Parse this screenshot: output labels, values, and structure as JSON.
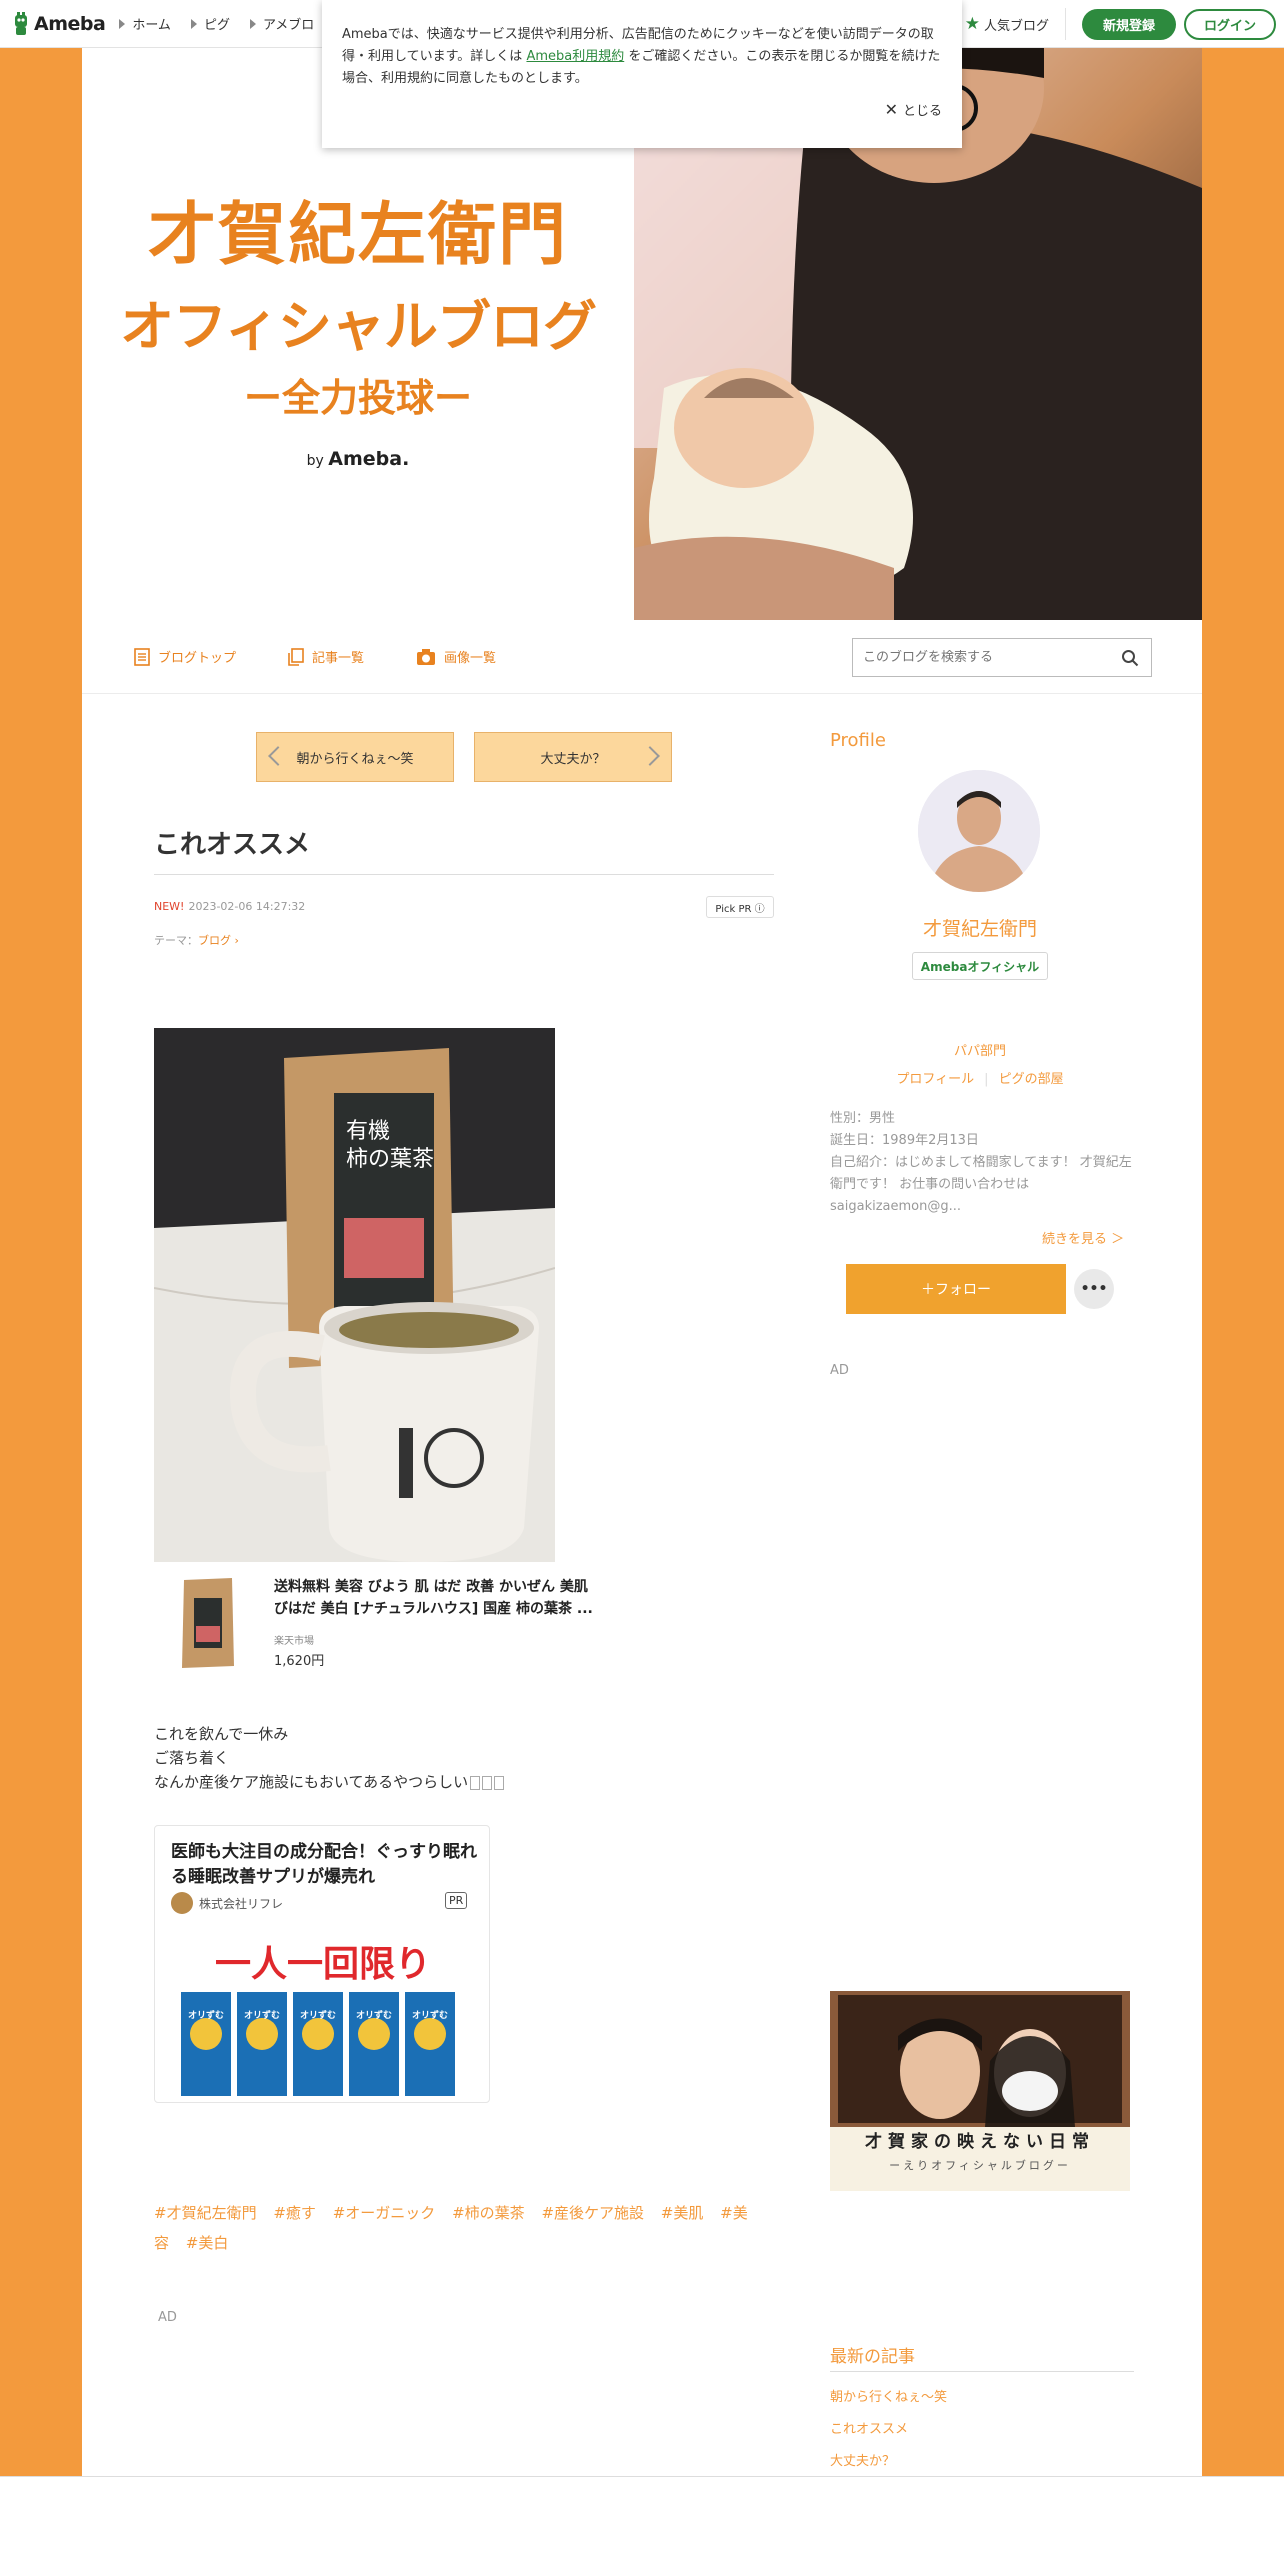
{
  "topbar": {
    "logo_text": "Ameba",
    "nav": [
      "ホーム",
      "ピグ",
      "アメブロ"
    ],
    "popular_blog": "人気ブログ",
    "register": "新規登録",
    "login": "ログイン",
    "accent_color": "#2d8a3e"
  },
  "cookie": {
    "text_before": "Amebaでは、快適なサービス提供や利用分析、広告配信のためにクッキーなどを使い訪問データの取得・利用しています。詳しくは",
    "link": "Ameba利用規約",
    "text_after": "をご確認ください。この表示を閉じるか閲覧を続けた場合、利用規約に同意したものとします。",
    "close": "とじる"
  },
  "header": {
    "line1": "才賀紀左衛門",
    "line2": "オフィシャルブログ",
    "line3": "ー全力投球ー",
    "by": "by",
    "by_brand": "Ameba."
  },
  "blognav": {
    "items": [
      "ブログトップ",
      "記事一覧",
      "画像一覧"
    ],
    "search_placeholder": "このブログを検索する"
  },
  "article": {
    "prev": "朝から行くねぇ〜笑",
    "next": "大丈夫か？",
    "title": "これオススメ",
    "new": "NEW!",
    "date": "2023-02-06 14:27:32",
    "pick_pr": "Pick PR ⓘ",
    "theme_label": "テーマ：",
    "theme": "ブログ",
    "product": {
      "title": "送料無料 美容 びよう 肌 はだ 改善 かいぜん 美肌 びはだ 美白 [ナチュラルハウス] 国産 柿の葉茶 ...",
      "shop": "楽天市場",
      "price": "1,620円"
    },
    "body_lines": [
      "これを飲んで一休み",
      "ご落ち着く",
      "なんか産後ケア施設にもおいてあるやつらしい"
    ],
    "ad": {
      "title": "医師も大注目の成分配合！ぐっすり眠れる睡眠改善サプリが爆売れ",
      "advertiser": "株式会社リフレ",
      "pr": "PR",
      "banner": "一人一回限り",
      "product_name": "オリずむ"
    },
    "hashtags": [
      "#才賀紀左衛門",
      "#癒す",
      "#オーガニック",
      "#柿の葉茶",
      "#産後ケア施設",
      "#美肌",
      "#美容",
      "#美白"
    ],
    "ad_label": "AD"
  },
  "sidebar": {
    "profile_title": "Profile",
    "name": "才賀紀左衛門",
    "badge": "Amebaオフィシャル",
    "category": "パパ部門",
    "link_profile": "プロフィール",
    "link_room": "ピグの部屋",
    "gender": "性別：男性",
    "birthday": "誕生日：1989年2月13日",
    "intro": "自己紹介：はじめまして格闘家してます！ 才賀紀左衛門です！ お仕事の問い合わせは saigakizaemon@g...",
    "more": "続きを見る ＞",
    "follow": "＋フォロー",
    "more_btn": "•••",
    "ad_label": "AD",
    "banner_caption": "才賀家の映えない日常",
    "banner_sub": "ーえりオフィシャルブログー",
    "recent_title": "最新の記事",
    "recent": [
      "朝から行くねぇ〜笑",
      "これオススメ",
      "大丈夫か？"
    ]
  }
}
